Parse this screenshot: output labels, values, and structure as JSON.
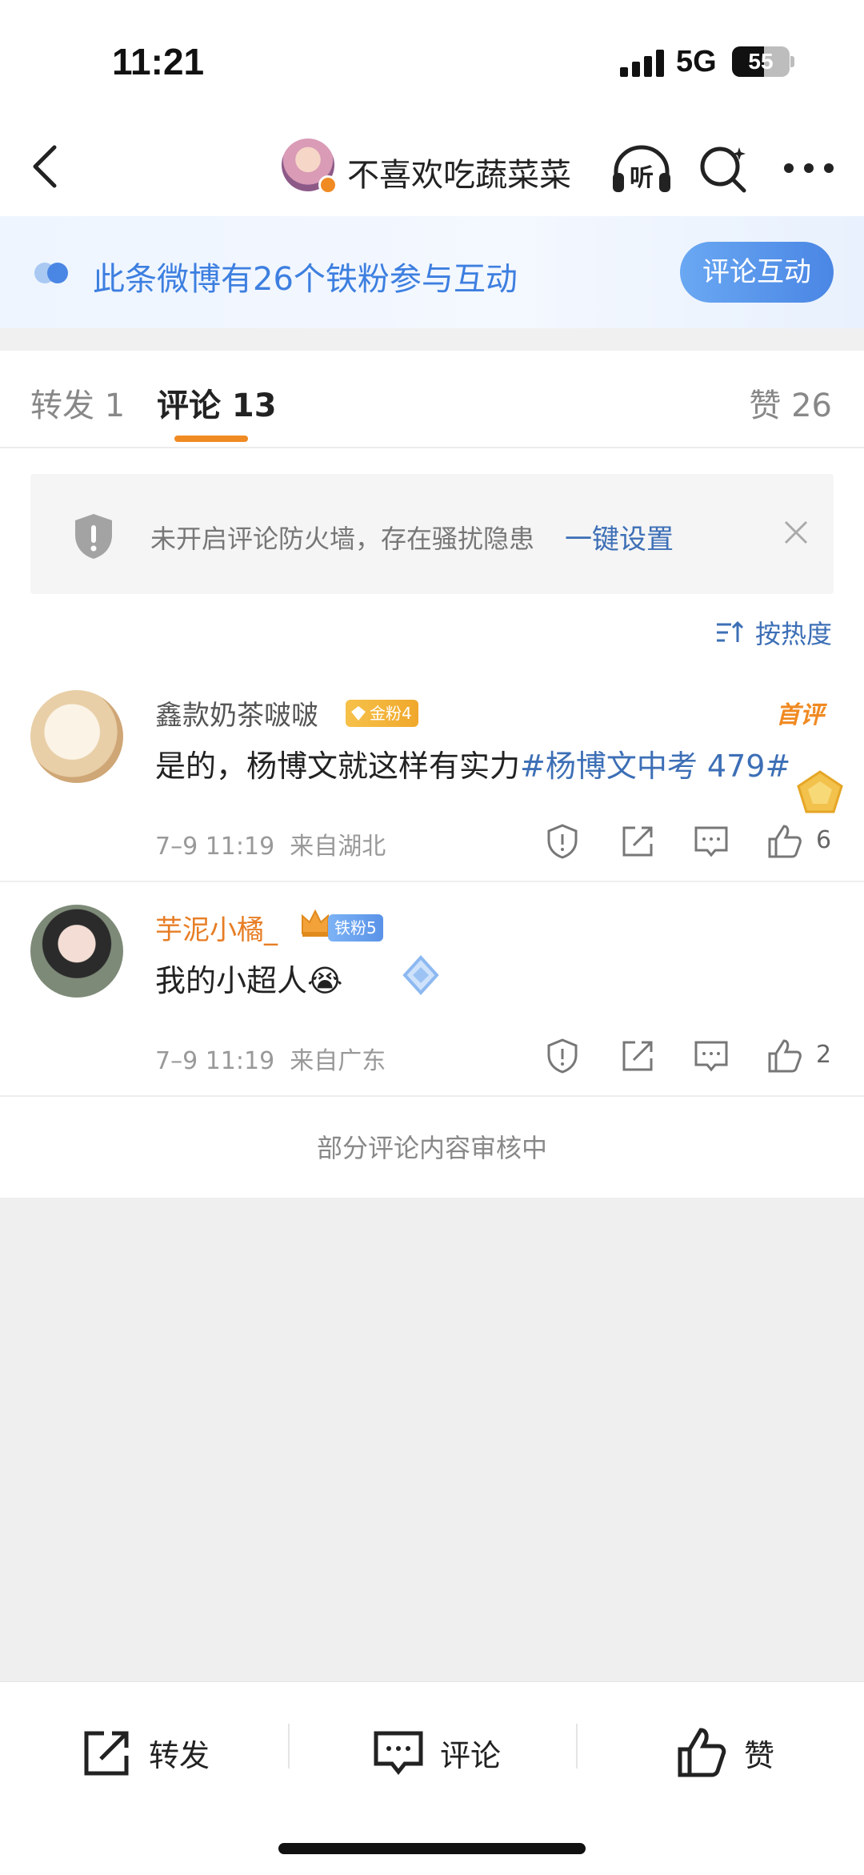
{
  "status_bar": {
    "time": "11:21",
    "network": "5G",
    "battery": "55",
    "battery_level": 0.55
  },
  "nav": {
    "user_name": "不喜欢吃蔬菜菜",
    "listen_label": "听"
  },
  "banner": {
    "text": "此条微博有26个铁粉参与互动",
    "button": "评论互动"
  },
  "tabs": {
    "repost": "转发 1",
    "comment": "评论 13",
    "like": "赞 26",
    "active": "comment"
  },
  "firewall_tip": {
    "message": "未开启评论防火墙，存在骚扰隐患",
    "link": "一键设置"
  },
  "sort": {
    "label": "按热度"
  },
  "comments": [
    {
      "user": "鑫款奶茶啵啵",
      "badge": "金粉4",
      "first_label": "首评",
      "text": "是的，杨博文就这样有实力",
      "hashtag": "#杨博文中考 479#",
      "time": "7–9 11:19",
      "location": "来自湖北",
      "likes": "6"
    },
    {
      "user": "芋泥小橘_",
      "badge": "铁粉5",
      "text": "我的小超人",
      "emoji": "😭",
      "time": "7–9 11:19",
      "location": "来自广东",
      "likes": "2"
    }
  ],
  "review_notice": "部分评论内容审核中",
  "toolbar": {
    "repost": "转发",
    "comment": "评论",
    "like": "赞"
  },
  "colors": {
    "accent_orange": "#f08a22",
    "link_blue": "#3d6fb6",
    "banner_blue": "#3d7fe0"
  }
}
